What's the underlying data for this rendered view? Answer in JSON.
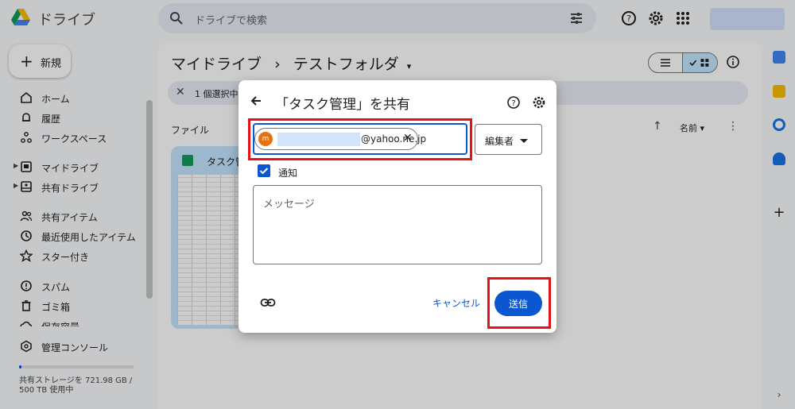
{
  "app": {
    "title": "ドライブ",
    "logo_icon": "google-drive-logo"
  },
  "search": {
    "placeholder": "ドライブで検索"
  },
  "new_button": {
    "label": "新規"
  },
  "sidebar": {
    "items": [
      {
        "label": "ホーム",
        "icon": "home-icon"
      },
      {
        "label": "履歴",
        "icon": "bell-icon"
      },
      {
        "label": "ワークスペース",
        "icon": "workspaces-icon"
      },
      {
        "label": "マイドライブ",
        "icon": "my-drive-icon"
      },
      {
        "label": "共有ドライブ",
        "icon": "shared-drives-icon"
      },
      {
        "label": "共有アイテム",
        "icon": "people-icon"
      },
      {
        "label": "最近使用したアイテム",
        "icon": "clock-icon"
      },
      {
        "label": "スター付き",
        "icon": "star-icon"
      },
      {
        "label": "スパム",
        "icon": "spam-icon"
      },
      {
        "label": "ゴミ箱",
        "icon": "trash-icon"
      },
      {
        "label": "保存容量",
        "icon": "cloud-icon"
      },
      {
        "label": "管理コンソール",
        "icon": "admin-icon"
      }
    ],
    "storage_text": "共有ストレージを 721.98 GB / 500 TB 使用中",
    "storage_used_fraction": 0.02
  },
  "main": {
    "breadcrumb": [
      "マイドライブ",
      "›",
      "テストフォルダ"
    ],
    "selection_text": "1 個選択中",
    "files_header": "ファイル",
    "sort_label": "名前",
    "file_name": "タスク管"
  },
  "dialog": {
    "title": "「タスク管理」を共有",
    "recipient_initial": "m",
    "recipient_email": "@yahoo.ne.jp",
    "role": "編集者",
    "notify_label": "通知",
    "message_placeholder": "メッセージ",
    "cancel_label": "キャンセル",
    "send_label": "送信"
  },
  "colors": {
    "accent": "#0b57d0",
    "highlight": "#e5121b",
    "chip_avatar": "#e8710a"
  }
}
